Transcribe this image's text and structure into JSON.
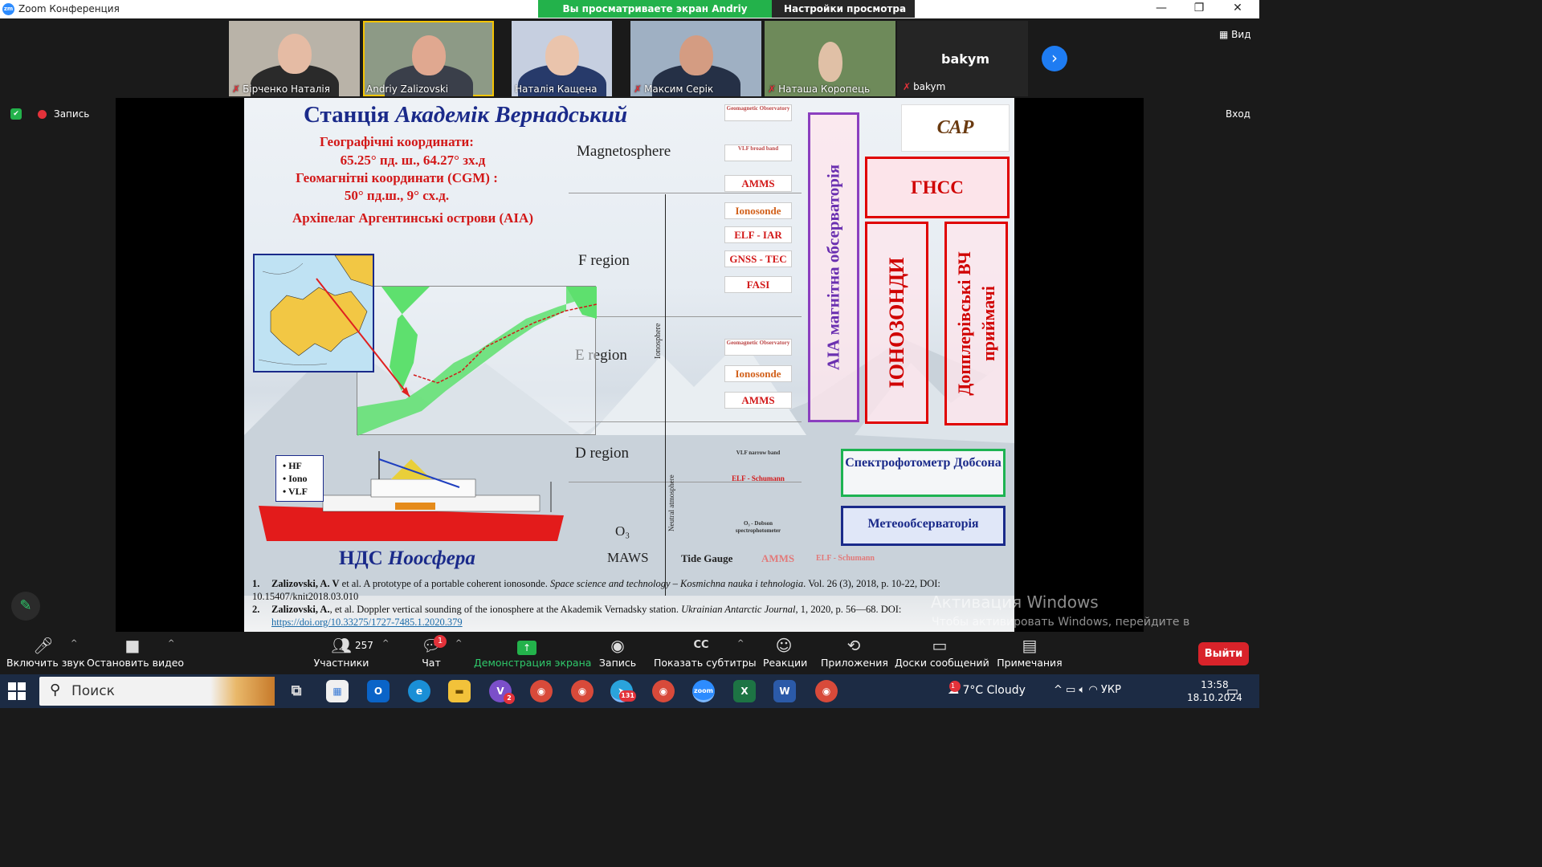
{
  "window": {
    "title": "Zoom Конференция",
    "share_banner": "Вы просматриваете экран Andriy Zalizovski",
    "view_options": "Настройки просмотра"
  },
  "participants": [
    {
      "name": "Бірченко Наталія",
      "muted": true
    },
    {
      "name": "Andriy Zalizovski",
      "muted": false
    },
    {
      "name": "Наталія Кащена",
      "muted": false
    },
    {
      "name": "Максим Серік",
      "muted": true
    },
    {
      "name": "Наташа Коропець",
      "muted": true
    },
    {
      "name": "bakym",
      "muted": true
    }
  ],
  "bakym_big": "bakym",
  "top_right": {
    "view": "Вид",
    "login": "Вход"
  },
  "recording": {
    "label": "Запись"
  },
  "slide": {
    "title_a": "Станція ",
    "title_b": "Академік Вернадський",
    "geo_label": "Географічні координати:",
    "geo_value": "65.25° пд. ш., 64.27° зх.д",
    "geomag_label": "Геомагнітні координати (CGM) :",
    "geomag_value": "50° пд.ш., 9° сх.д.",
    "archipelago": "Архіпелаг Аргентинські острови (АІА)",
    "layers": {
      "magnetosphere": "Magnetosphere",
      "f": "F region",
      "e": "E region",
      "d": "D region",
      "o3": "O₃",
      "maws": "MAWS",
      "tide": "Tide Gauge"
    },
    "axis": {
      "ionosphere": "Ionosphere",
      "neutral": "Neutral atmosphere"
    },
    "instruments": {
      "geomag1": "Geomagnetic Observatory",
      "vlf1": "VLF broad band",
      "amms1": "AMMS",
      "ionosonde1": "Ionosonde",
      "elf_iar": "ELF - IAR",
      "gnss_tec": "GNSS - TEC",
      "fasi": "FASI",
      "geomag2": "Geomagnetic Observatory",
      "ionosonde2": "Ionosonde",
      "amms2": "AMMS",
      "vlf2": "VLF narrow band",
      "elf_sch": "ELF - Schumann",
      "dobson_small": "O₃ - Dobson spectrophotometer",
      "amms3": "AMMS",
      "elf_sch2": "ELF - Schumann"
    },
    "boxes": {
      "obs": "АІА магнітна обсерваторія",
      "iono": "ІОНОЗОНДИ",
      "doppler": "Допплерівські ВЧ приймачі",
      "gnss": "ГНСС",
      "dobson": "Спектрофотометр Добсона",
      "meteo": "Метеообсерваторія",
      "logo": "САР"
    },
    "ship_list": [
      "• HF",
      "• Iono",
      "• VLF"
    ],
    "ship_title_a": "НДС ",
    "ship_title_b": "Ноосфера",
    "refs": [
      {
        "n": "1.",
        "author": "Zalizovski, A. V",
        "text": " et al. A prototype of a portable coherent ionosonde. ",
        "journal": "Space science and technology – Kosmichna nauka i tehnologia",
        "tail": ". Vol. 26 (3), 2018, p. 10-22, DOI: 10.15407/knit2018.03.010"
      },
      {
        "n": "2.",
        "author": "Zalizovski, A.",
        "text": ", et al.  Doppler vertical sounding of the ionosphere at the Akademik Vernadsky station. ",
        "journal": "Ukrainian Antarctic Journal",
        "tail": ", 1, 2020, p. 56—68. DOI:",
        "link": "https://doi.org/10.33275/1727-7485.1.2020.379"
      }
    ]
  },
  "watermark": {
    "title": "Активация Windows",
    "body": "Чтобы активировать Windows, перейдите в раздел \"Параметры\"."
  },
  "toolbar": {
    "audio": "Включить звук",
    "video": "Остановить видео",
    "participants": "Участники",
    "participants_count": "257",
    "chat": "Чат",
    "chat_badge": "1",
    "share": "Демонстрация экрана",
    "record": "Запись",
    "cc": "Показать субтитры",
    "reactions": "Реакции",
    "apps": "Приложения",
    "whiteboards": "Доски сообщений",
    "notes": "Примечания",
    "leave": "Выйти"
  },
  "taskbar": {
    "search": "Поиск",
    "weather": "7°C  Cloudy",
    "lang": "УКР",
    "time": "13:58",
    "date": "18.10.2024",
    "viber_badge": "2",
    "telegram_badge": "131",
    "weather_badge": "1"
  }
}
